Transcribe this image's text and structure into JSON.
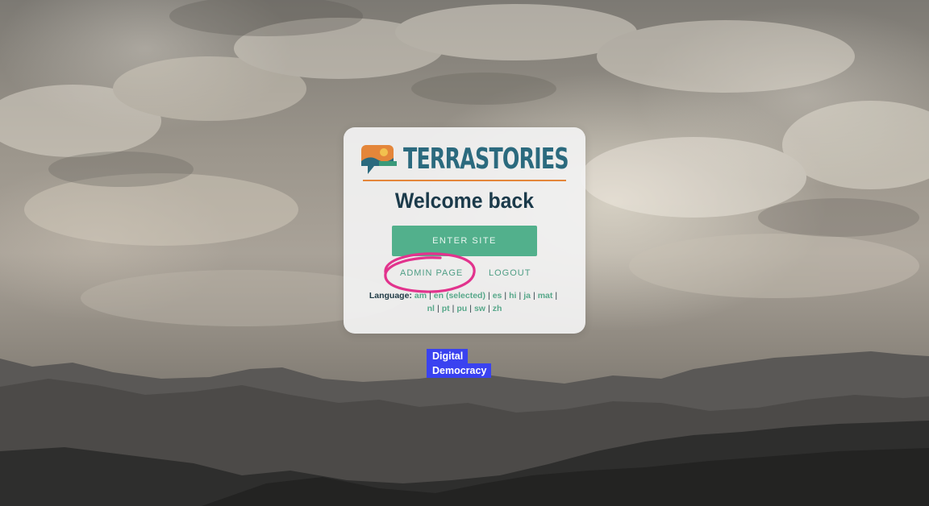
{
  "brand": {
    "logo_text": "TERRASTORIES",
    "accent_color": "#2b6a7e",
    "rule_color": "#e4863a"
  },
  "card": {
    "title": "Welcome back",
    "enter_button": "ENTER SITE",
    "admin_link": "ADMIN PAGE",
    "logout_link": "LOGOUT",
    "button_color": "#52b08c",
    "highlight_color": "#e2338d"
  },
  "language": {
    "label": "Language:",
    "options": [
      {
        "code": "am"
      },
      {
        "code": "en (selected)"
      },
      {
        "code": "es"
      },
      {
        "code": "hi"
      },
      {
        "code": "ja"
      },
      {
        "code": "mat"
      },
      {
        "code": "nl"
      },
      {
        "code": "pt"
      },
      {
        "code": "pu"
      },
      {
        "code": "sw"
      },
      {
        "code": "zh"
      }
    ],
    "separator": "|"
  },
  "partner": {
    "line1": "Digital",
    "line2": "Democracy",
    "badge_color": "#3a42f0"
  }
}
